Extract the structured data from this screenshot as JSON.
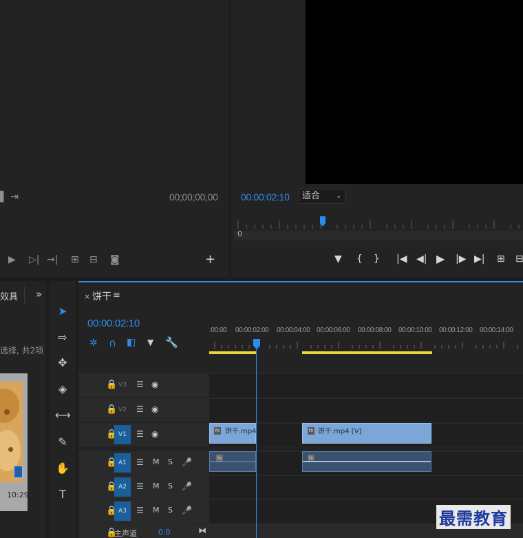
{
  "source": {
    "timecode": "00;00;00;00"
  },
  "program": {
    "timecode": "00:00:02:10",
    "fit_label": "适合",
    "playhead_label": "0"
  },
  "project": {
    "tab_label": "效具",
    "overflow": "»",
    "selection_text": "选择, 共2项",
    "thumb_duration": "10:29"
  },
  "timeline": {
    "close": "×",
    "sequence_name": "饼干",
    "menu": "≡",
    "timecode": "00:00:02:10",
    "ruler_labels": [
      ":00:00",
      "00:00:02:00",
      "00:00:04:00",
      "00:00:06:00",
      "00:00:08:00",
      "00:00:10:00",
      "00:00:12:00",
      "00:00:14:00"
    ],
    "tracks": [
      {
        "name": "V3"
      },
      {
        "name": "V2"
      },
      {
        "name": "V1"
      },
      {
        "name": "A1"
      },
      {
        "name": "A2"
      },
      {
        "name": "A3"
      }
    ],
    "master_label": "主声道",
    "master_value": "0.0",
    "clip_v1_a": "饼干.mp4 [",
    "clip_v1_b": "饼干.mp4 [V]",
    "clip_fx": "fx",
    "m_label": "M",
    "s_label": "S"
  },
  "watermark": "最需教育",
  "colors": {
    "accent": "#2d8ceb",
    "work_area": "#e8d53a",
    "video_clip": "#7da6d8",
    "audio_clip": "#3a5270"
  }
}
